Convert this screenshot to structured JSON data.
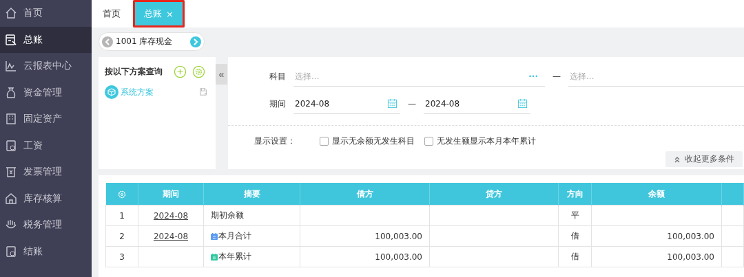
{
  "sidebar": {
    "items": [
      {
        "label": "首页",
        "selected": false
      },
      {
        "label": "总账",
        "selected": true
      },
      {
        "label": "云报表中心",
        "selected": false
      },
      {
        "label": "资金管理",
        "selected": false
      },
      {
        "label": "固定资产",
        "selected": false
      },
      {
        "label": "工资",
        "selected": false
      },
      {
        "label": "发票管理",
        "selected": false
      },
      {
        "label": "库存核算",
        "selected": false
      },
      {
        "label": "税务管理",
        "selected": false
      },
      {
        "label": "结账",
        "selected": false
      }
    ]
  },
  "tabs": [
    {
      "label": "首页",
      "selected": false
    },
    {
      "label": "总账",
      "selected": true,
      "close": "×"
    }
  ],
  "account": "1001 库存现金",
  "scheme": {
    "title": "按以下方案查询",
    "items": [
      {
        "label": "系统方案"
      }
    ],
    "collapse": "«"
  },
  "filters": {
    "subject_label": "科目",
    "subject_from": {
      "placeholder": "选择..."
    },
    "subject_more": "···",
    "dash": "—",
    "subject_to": {
      "placeholder": "选择..."
    },
    "period_label": "期间",
    "period_from": "2024-08",
    "period_to": "2024-08",
    "display_label": "显示设置：",
    "options": [
      {
        "label": "显示无余额无发生科目",
        "checked": false
      },
      {
        "label": "无发生额显示本月本年累计",
        "checked": false
      }
    ],
    "toggle": "收起更多条件"
  },
  "table": {
    "columns": [
      "期间",
      "摘要",
      "借方",
      "贷方",
      "方向",
      "余额"
    ],
    "rows": [
      {
        "no": "1",
        "period": "2024-08",
        "summary": "期初余额",
        "kind": "plain",
        "direction": "平"
      },
      {
        "no": "2",
        "period": "2024-08",
        "summary": "本月合计",
        "kind": "month",
        "debit": "100,003.00",
        "direction": "借",
        "balance": "100,003.00"
      },
      {
        "no": "3",
        "summary": "本年累计",
        "kind": "year",
        "debit": "100,003.00",
        "direction": "借",
        "balance": "100,003.00"
      }
    ]
  }
}
